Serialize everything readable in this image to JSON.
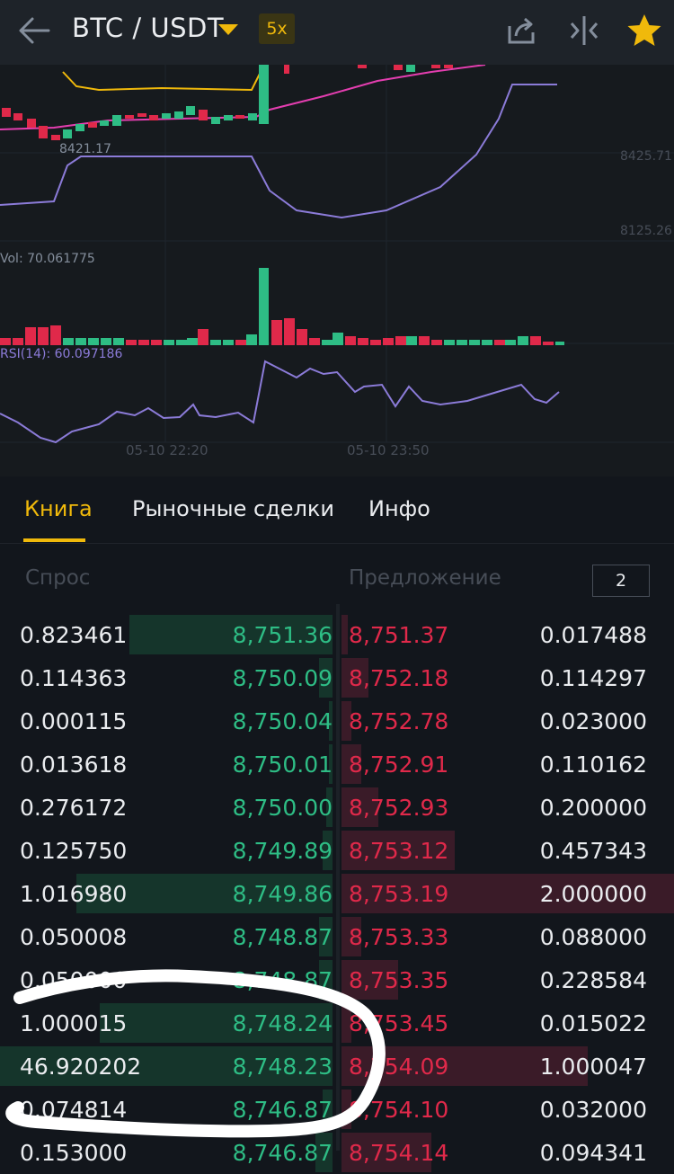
{
  "header": {
    "pair": "BTC / USDT",
    "leverage": "5x"
  },
  "chart": {
    "price_labels": [
      "8421.17",
      "8425.71",
      "8125.26"
    ],
    "volume_label": "Vol: 70.061775",
    "rsi_label": "RSI(14): 60.097186",
    "time_labels": [
      "05-10 22:20",
      "05-10 23:50"
    ]
  },
  "tabs": [
    {
      "label": "Книга"
    },
    {
      "label": "Рыночные сделки"
    },
    {
      "label": "Инфо"
    }
  ],
  "book": {
    "bid_label": "Спрос",
    "ask_label": "Предложение",
    "depth": "2",
    "rows": [
      {
        "bid_qty": "0.823461",
        "bid_price": "8,751.36",
        "ask_price": "8,751.37",
        "ask_qty": "0.017488",
        "bid_depth": 0.61,
        "ask_depth": 0.02
      },
      {
        "bid_qty": "0.114363",
        "bid_price": "8,750.09",
        "ask_price": "8,752.18",
        "ask_qty": "0.114297",
        "bid_depth": 0.04,
        "ask_depth": 0.08
      },
      {
        "bid_qty": "0.000115",
        "bid_price": "8,750.04",
        "ask_price": "8,752.78",
        "ask_qty": "0.023000",
        "bid_depth": 0.01,
        "ask_depth": 0.03
      },
      {
        "bid_qty": "0.013618",
        "bid_price": "8,750.01",
        "ask_price": "8,752.91",
        "ask_qty": "0.110162",
        "bid_depth": 0.01,
        "ask_depth": 0.06
      },
      {
        "bid_qty": "0.276172",
        "bid_price": "8,750.00",
        "ask_price": "8,752.93",
        "ask_qty": "0.200000",
        "bid_depth": 0.02,
        "ask_depth": 0.11
      },
      {
        "bid_qty": "0.125750",
        "bid_price": "8,749.89",
        "ask_price": "8,753.12",
        "ask_qty": "0.457343",
        "bid_depth": 0.03,
        "ask_depth": 0.34
      },
      {
        "bid_qty": "1.016980",
        "bid_price": "8,749.86",
        "ask_price": "8,753.19",
        "ask_qty": "2.000000",
        "bid_depth": 0.77,
        "ask_depth": 1.0
      },
      {
        "bid_qty": "0.050008",
        "bid_price": "8,748.87",
        "ask_price": "8,753.33",
        "ask_qty": "0.088000",
        "bid_depth": 0.04,
        "ask_depth": 0.06
      },
      {
        "bid_qty": "0.050000",
        "bid_price": "8,748.87",
        "ask_price": "8,753.35",
        "ask_qty": "0.228584",
        "bid_depth": 0.04,
        "ask_depth": 0.17
      },
      {
        "bid_qty": "1.000015",
        "bid_price": "8,748.24",
        "ask_price": "8,753.45",
        "ask_qty": "0.015022",
        "bid_depth": 0.7,
        "ask_depth": 0.03
      },
      {
        "bid_qty": "46.920202",
        "bid_price": "8,748.23",
        "ask_price": "8,754.09",
        "ask_qty": "1.000047",
        "bid_depth": 1.0,
        "ask_depth": 0.74
      },
      {
        "bid_qty": "0.074814",
        "bid_price": "8,746.87",
        "ask_price": "8,754.10",
        "ask_qty": "0.032000",
        "bid_depth": 0.03,
        "ask_depth": 0.03
      },
      {
        "bid_qty": "0.153000",
        "bid_price": "8,746.87",
        "ask_price": "8,754.14",
        "ask_qty": "0.094341",
        "bid_depth": 0.05,
        "ask_depth": 0.27
      }
    ]
  },
  "colors": {
    "buy": "#2ebd85",
    "sell": "#e0294a",
    "accent": "#f0b90b",
    "background": "#12161c"
  }
}
